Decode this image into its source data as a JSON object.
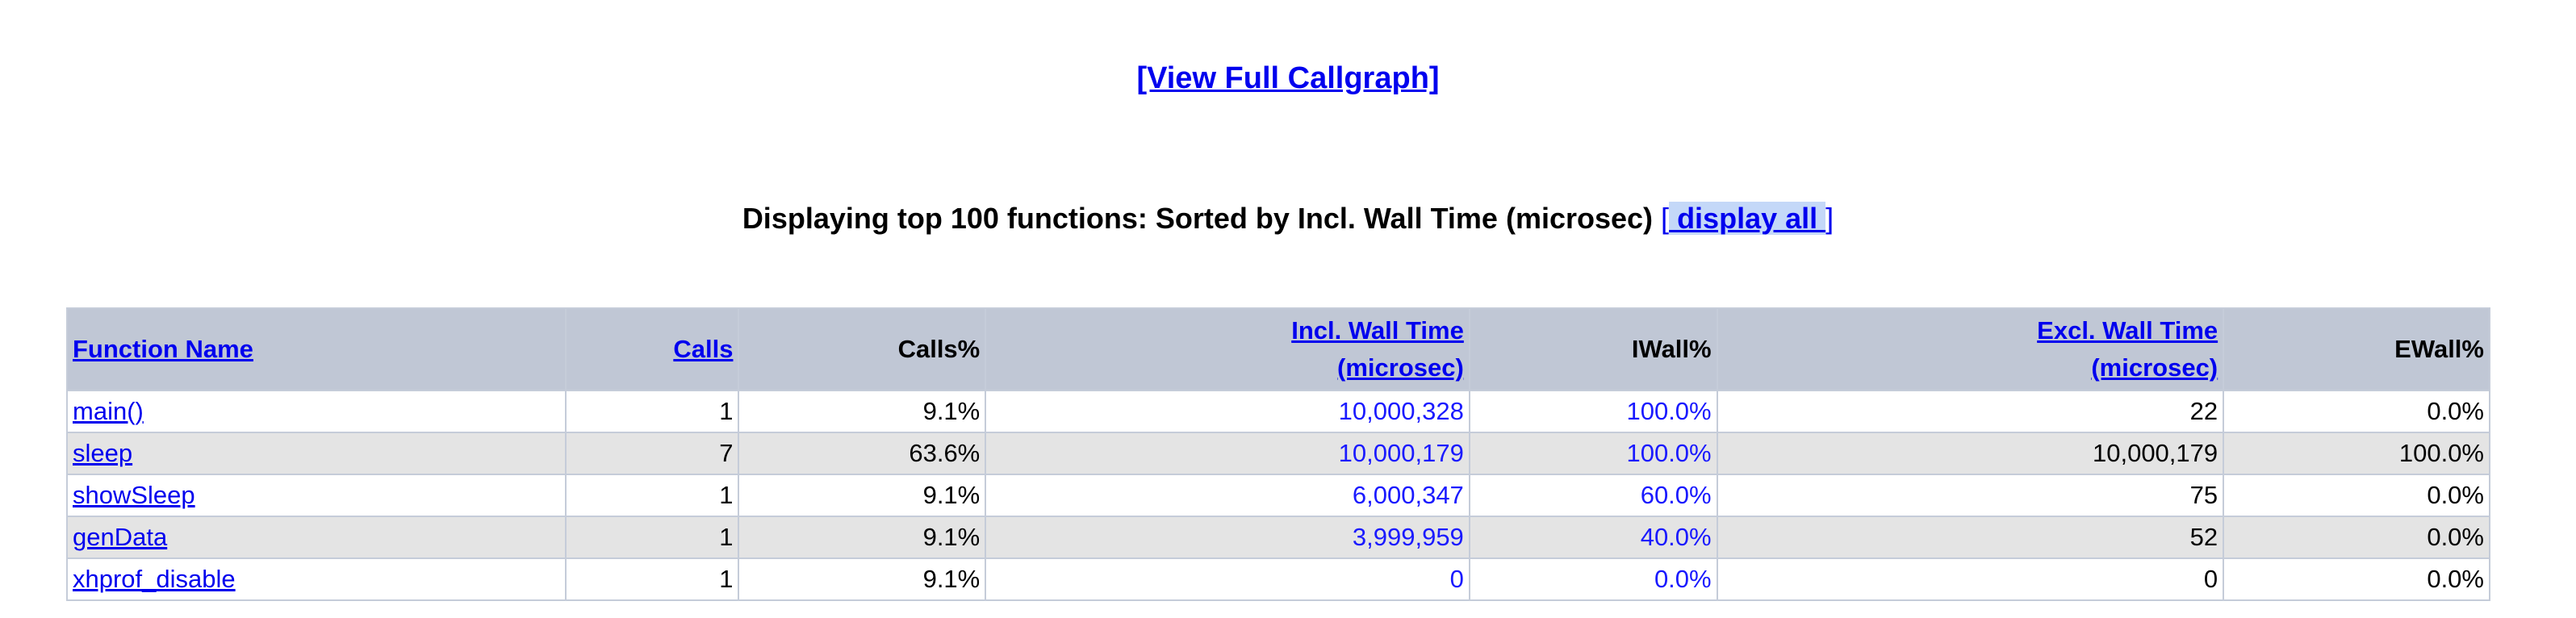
{
  "links": {
    "callgraph": "[View Full Callgraph]"
  },
  "summary": {
    "text": "Displaying top 100 functions: Sorted by Incl. Wall Time (microsec)",
    "open_bracket": "[",
    "display_all": " display all ",
    "close_bracket": "]"
  },
  "table": {
    "headers": {
      "function_name": "Function Name",
      "calls": "Calls",
      "calls_pct": "Calls%",
      "incl_wall_1": "Incl. Wall Time",
      "incl_wall_2": "(microsec)",
      "iwall_pct": "IWall%",
      "excl_wall_1": "Excl. Wall Time",
      "excl_wall_2": "(microsec)",
      "ewall_pct": "EWall%"
    },
    "rows": [
      {
        "name": "main()",
        "calls": "1",
        "calls_pct": "9.1%",
        "incl": "10,000,328",
        "iwall": "100.0%",
        "excl": "22",
        "ewall": "0.0%"
      },
      {
        "name": "sleep",
        "calls": "7",
        "calls_pct": "63.6%",
        "incl": "10,000,179",
        "iwall": "100.0%",
        "excl": "10,000,179",
        "ewall": "100.0%"
      },
      {
        "name": "showSleep",
        "calls": "1",
        "calls_pct": "9.1%",
        "incl": "6,000,347",
        "iwall": "60.0%",
        "excl": "75",
        "ewall": "0.0%"
      },
      {
        "name": "genData",
        "calls": "1",
        "calls_pct": "9.1%",
        "incl": "3,999,959",
        "iwall": "40.0%",
        "excl": "52",
        "ewall": "0.0%"
      },
      {
        "name": "xhprof_disable",
        "calls": "1",
        "calls_pct": "9.1%",
        "incl": "0",
        "iwall": "0.0%",
        "excl": "0",
        "ewall": "0.0%"
      }
    ]
  },
  "colors": {
    "link": "#0000ee",
    "header_bg": "#c0c7d5",
    "alt_row_bg": "#e4e4e4",
    "selection": "#c4d8f8"
  }
}
